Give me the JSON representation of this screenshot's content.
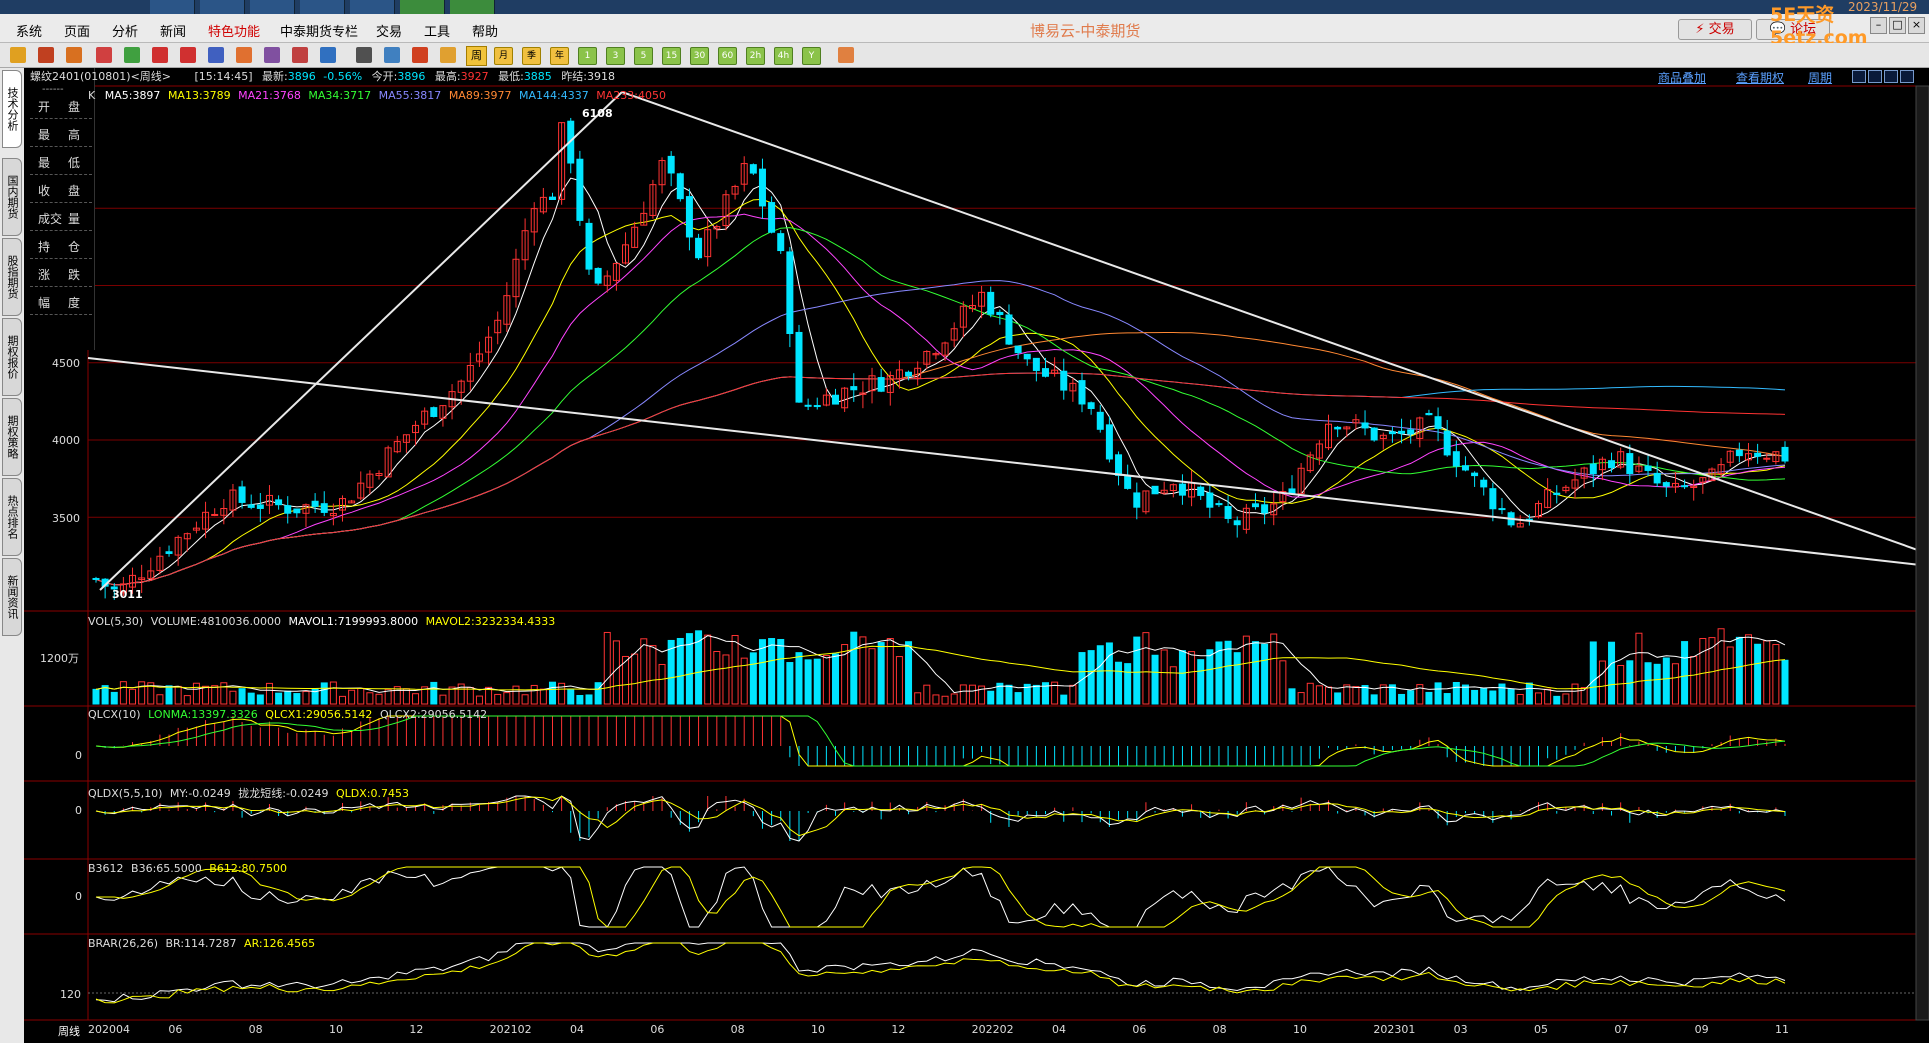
{
  "menubar": {
    "items": [
      "系统",
      "页面",
      "分析",
      "新闻",
      "特色功能",
      "中泰期货专栏",
      "交易",
      "工具",
      "帮助"
    ],
    "title": "博易云-中泰期货",
    "trade": "交易",
    "forum": "论坛",
    "watermark": "5E天资5etz.com",
    "datestamp": "2023/11/29"
  },
  "toolbar": {
    "periods": [
      "1",
      "3",
      "5",
      "15",
      "30",
      "60",
      "2h",
      "4h",
      "Y"
    ],
    "selected": "周",
    "m": "月",
    "q": "季",
    "n": "年"
  },
  "leftbar": {
    "tabs": [
      "技术分析",
      "国内期货",
      "股指期货",
      "期权报价",
      "期权策略",
      "热点排名",
      "新闻资讯"
    ]
  },
  "quote": {
    "rows": [
      [
        "开",
        "盘"
      ],
      [
        "最",
        "高"
      ],
      [
        "最",
        "低"
      ],
      [
        "收",
        "盘"
      ],
      [
        "成交",
        "量"
      ],
      [
        "持",
        "仓"
      ],
      [
        "涨",
        "跌"
      ],
      [
        "幅",
        "度"
      ]
    ],
    "sep": "------"
  },
  "header": {
    "contract": "螺纹2401(010801)<周线>",
    "time": "[15:14:45]",
    "last_label": "最新:",
    "last": "3896",
    "chg": "-0.56%",
    "open_label": "今开:",
    "open": "3896",
    "high_label": "最高:",
    "high": "3927",
    "low_label": "最低:",
    "low": "3885",
    "prev_label": "昨结:",
    "prev": "3918",
    "links": [
      "商品叠加",
      "查看期权",
      "周期"
    ]
  },
  "ma": {
    "k": "K",
    "items": [
      {
        "label": "MA5:3897",
        "color": "#ffffff"
      },
      {
        "label": "MA13:3789",
        "color": "#ffff00"
      },
      {
        "label": "MA21:3768",
        "color": "#ff44ff"
      },
      {
        "label": "MA34:3717",
        "color": "#33ff33"
      },
      {
        "label": "MA55:3817",
        "color": "#8888ff"
      },
      {
        "label": "MA89:3977",
        "color": "#ff8833"
      },
      {
        "label": "MA144:4337",
        "color": "#33bbff"
      },
      {
        "label": "MA233:4050",
        "color": "#ff3333"
      }
    ]
  },
  "price_axis": {
    "labels": [
      "4500",
      "4000",
      "3500"
    ],
    "peak": "6108",
    "trough": "3011"
  },
  "vol": {
    "title": "VOL(5,30)",
    "volume": "VOLUME:4810036.0000",
    "mavol1": "MAVOL1:7199993.8000",
    "mavol2": "MAVOL2:3232334.4333",
    "axis": "1200万"
  },
  "qlcx": {
    "title": "QLCX(10)",
    "lonma": "LONMA:13397.3326",
    "qlcx1": "QLCX1:29056.5142",
    "qlcx2": "QLCX2:29056.5142",
    "axis": "0"
  },
  "qldx": {
    "title": "QLDX(5,5,10)",
    "my": "MY:-0.0249",
    "short": "拢龙短线:-0.0249",
    "qldx": "QLDX:0.7453",
    "axis": "0"
  },
  "b3612": {
    "title": "B3612",
    "b36": "B36:65.5000",
    "b612": "B612:80.7500",
    "axis": "0"
  },
  "brar": {
    "title": "BRAR(26,26)",
    "br": "BR:114.7287",
    "ar": "AR:126.4565",
    "axis": "120"
  },
  "xaxis": {
    "period": "周线",
    "labels": [
      "202004",
      "06",
      "08",
      "10",
      "12",
      "202102",
      "04",
      "06",
      "08",
      "10",
      "12",
      "202202",
      "04",
      "06",
      "08",
      "10",
      "202301",
      "03",
      "05",
      "07",
      "09",
      "11"
    ]
  },
  "colors": {
    "up": "#ff3333",
    "down": "#00e5ff",
    "grid": "#7a0000",
    "trend": "#e8e8e8"
  },
  "chart_data": {
    "type": "candlestick",
    "period": "weekly",
    "x_start": "202004",
    "x_end": "202311",
    "extremes": {
      "high": 6108,
      "low": 3011
    },
    "last": {
      "close": 3896,
      "open": 3896,
      "high": 3927,
      "low": 3885,
      "prev_settle": 3918,
      "change_pct": -0.56
    },
    "moving_averages": {
      "MA5": 3897,
      "MA13": 3789,
      "MA21": 3768,
      "MA34": 3717,
      "MA55": 3817,
      "MA89": 3977,
      "MA144": 4337,
      "MA233": 4050
    }
  }
}
